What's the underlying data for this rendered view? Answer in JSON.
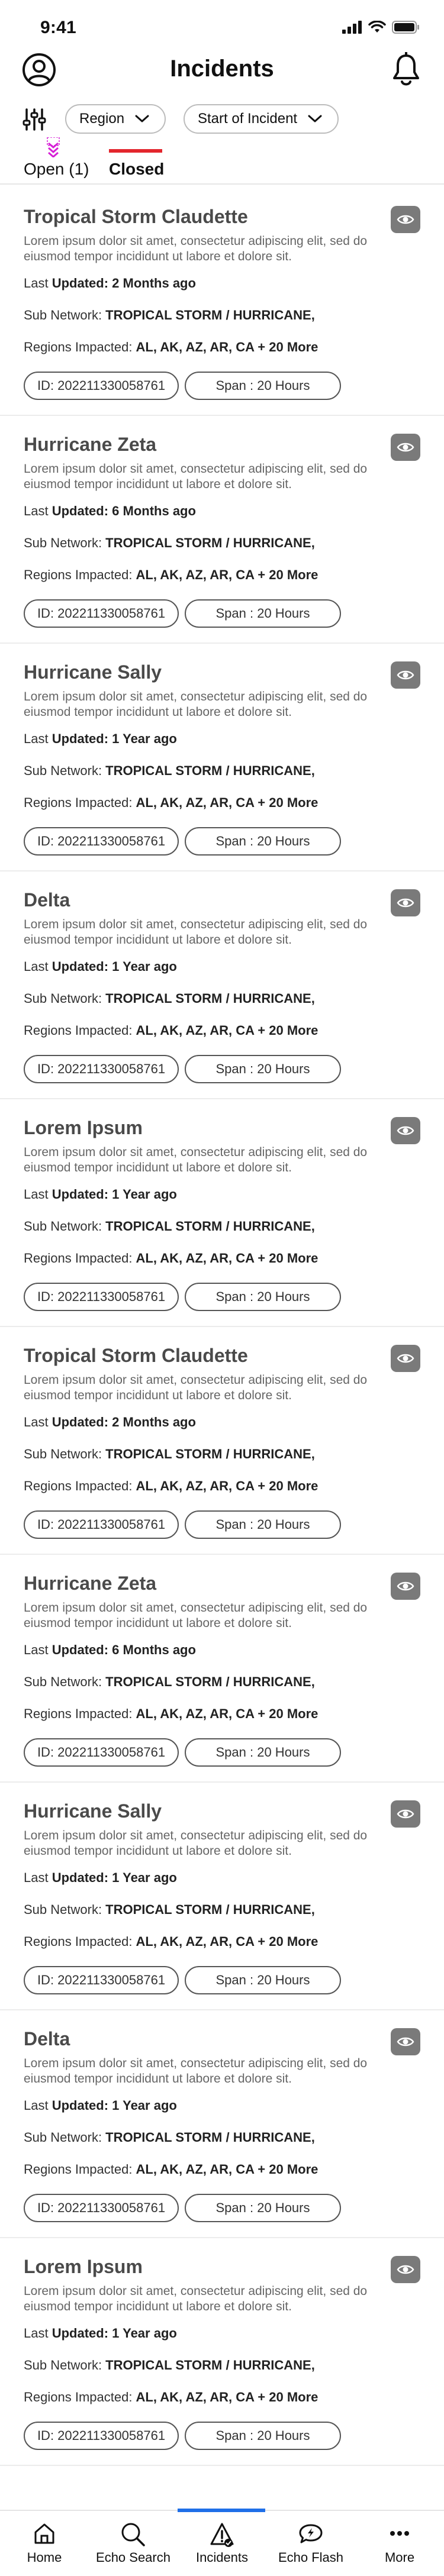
{
  "status_bar": {
    "time": "9:41"
  },
  "header": {
    "title": "Incidents"
  },
  "filters": {
    "region_label": "Region",
    "start_label": "Start of Incident"
  },
  "tabs": {
    "open_label": "Open (1)",
    "closed_label": "Closed"
  },
  "labels": {
    "last_prefix": "Last ",
    "updated": "Updated:",
    "sub_network": "Sub Network: ",
    "regions_impacted": "Regions Impacted: "
  },
  "incidents": [
    {
      "title": "Tropical Storm Claudette",
      "description": "Lorem ipsum dolor sit amet, consectetur adipiscing elit, sed do eiusmod tempor incididunt ut labore et dolore sit.",
      "updated_value": "2 Months ago",
      "sub_network": "TROPICAL STORM / HURRICANE,",
      "regions": "AL, AK, AZ, AR, CA + 20 More",
      "id": "ID: 202211330058761",
      "span": "Span : 20 Hours"
    },
    {
      "title": "Hurricane Zeta",
      "description": "Lorem ipsum dolor sit amet, consectetur adipiscing elit, sed do eiusmod tempor incididunt ut labore et dolore sit.",
      "updated_value": "6 Months ago",
      "sub_network": "TROPICAL STORM / HURRICANE,",
      "regions": "AL, AK, AZ, AR, CA + 20 More",
      "id": "ID: 202211330058761",
      "span": "Span : 20 Hours"
    },
    {
      "title": "Hurricane Sally",
      "description": "Lorem ipsum dolor sit amet, consectetur adipiscing elit, sed do eiusmod tempor incididunt ut labore et dolore sit.",
      "updated_value": "1 Year ago",
      "sub_network": "TROPICAL STORM / HURRICANE,",
      "regions": "AL, AK, AZ, AR, CA + 20 More",
      "id": "ID: 202211330058761",
      "span": "Span : 20 Hours"
    },
    {
      "title": "Delta",
      "description": "Lorem ipsum dolor sit amet, consectetur adipiscing elit, sed do eiusmod tempor incididunt ut labore et dolore sit.",
      "updated_value": "1 Year ago",
      "sub_network": "TROPICAL STORM / HURRICANE,",
      "regions": "AL, AK, AZ, AR, CA + 20 More",
      "id": "ID: 202211330058761",
      "span": "Span : 20 Hours"
    },
    {
      "title": "Lorem Ipsum",
      "description": "Lorem ipsum dolor sit amet, consectetur adipiscing elit, sed do eiusmod tempor incididunt ut labore et dolore sit.",
      "updated_value": "1 Year ago",
      "sub_network": "TROPICAL STORM / HURRICANE,",
      "regions": "AL, AK, AZ, AR, CA + 20 More",
      "id": "ID: 202211330058761",
      "span": "Span : 20 Hours"
    },
    {
      "title": "Tropical Storm Claudette",
      "description": "Lorem ipsum dolor sit amet, consectetur adipiscing elit, sed do eiusmod tempor incididunt ut labore et dolore sit.",
      "updated_value": "2 Months ago",
      "sub_network": "TROPICAL STORM / HURRICANE,",
      "regions": "AL, AK, AZ, AR, CA + 20 More",
      "id": "ID: 202211330058761",
      "span": "Span : 20 Hours"
    },
    {
      "title": "Hurricane Zeta",
      "description": "Lorem ipsum dolor sit amet, consectetur adipiscing elit, sed do eiusmod tempor incididunt ut labore et dolore sit.",
      "updated_value": "6 Months ago",
      "sub_network": "TROPICAL STORM / HURRICANE,",
      "regions": "AL, AK, AZ, AR, CA + 20 More",
      "id": "ID: 202211330058761",
      "span": "Span : 20 Hours"
    },
    {
      "title": "Hurricane Sally",
      "description": "Lorem ipsum dolor sit amet, consectetur adipiscing elit, sed do eiusmod tempor incididunt ut labore et dolore sit.",
      "updated_value": "1 Year ago",
      "sub_network": "TROPICAL STORM / HURRICANE,",
      "regions": "AL, AK, AZ, AR, CA + 20 More",
      "id": "ID: 202211330058761",
      "span": "Span : 20 Hours"
    },
    {
      "title": "Delta",
      "description": "Lorem ipsum dolor sit amet, consectetur adipiscing elit, sed do eiusmod tempor incididunt ut labore et dolore sit.",
      "updated_value": "1 Year ago",
      "sub_network": "TROPICAL STORM / HURRICANE,",
      "regions": "AL, AK, AZ, AR, CA + 20 More",
      "id": "ID: 202211330058761",
      "span": "Span : 20 Hours"
    },
    {
      "title": "Lorem Ipsum",
      "description": "Lorem ipsum dolor sit amet, consectetur adipiscing elit, sed do eiusmod tempor incididunt ut labore et dolore sit.",
      "updated_value": "1 Year ago",
      "sub_network": "TROPICAL STORM / HURRICANE,",
      "regions": "AL, AK, AZ, AR, CA + 20 More",
      "id": "ID: 202211330058761",
      "span": "Span : 20 Hours"
    }
  ],
  "bottom_nav": {
    "items": [
      {
        "label": "Home",
        "icon": "home-icon"
      },
      {
        "label": "Echo Search",
        "icon": "search-icon"
      },
      {
        "label": "Incidents",
        "icon": "incidents-icon"
      },
      {
        "label": "Echo Flash",
        "icon": "echo-flash-icon"
      },
      {
        "label": "More",
        "icon": "more-icon"
      }
    ],
    "active": "Incidents"
  },
  "colors": {
    "accent_red": "#e3262d",
    "active_blue": "#1f6fe8",
    "open_marker_magenta": "#d61fd6",
    "eye_button_gray": "#7a7a7a"
  }
}
